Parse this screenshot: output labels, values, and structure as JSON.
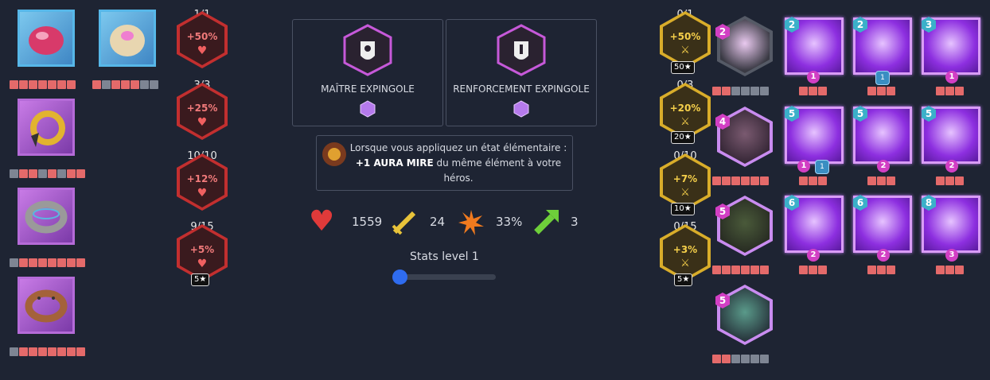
{
  "items_left": {
    "top_left_stars": 7,
    "top_left_filled": 7,
    "top_right_stars": 7,
    "top_right_filled": 4,
    "row2_stars": 6,
    "row2_filled": 3,
    "row3_stars": 6,
    "row3_filled": 6,
    "row4_stars": 6,
    "row4_filled": 6
  },
  "hp_bonuses": [
    {
      "count": "1/1",
      "label": "+50%"
    },
    {
      "count": "3/3",
      "label": "+25%"
    },
    {
      "count": "10/10",
      "label": "+12%"
    },
    {
      "count": "9/15",
      "label": "+5%",
      "tag": "5★"
    }
  ],
  "atk_bonuses": [
    {
      "count": "0/1",
      "label": "+50%",
      "tag": "50★"
    },
    {
      "count": "0/3",
      "label": "+20%",
      "tag": "20★"
    },
    {
      "count": "0/10",
      "label": "+7%",
      "tag": "10★"
    },
    {
      "count": "0/15",
      "label": "+3%",
      "tag": "5★"
    }
  ],
  "talents": [
    {
      "name": "MAÎTRE EXPINGOLE"
    },
    {
      "name": "RENFORCEMENT EXPINGOLE"
    }
  ],
  "description": {
    "part1": "Lorsque vous appliquez un état élémentaire : ",
    "bold": "+1 AURA MIRE",
    "part2": " du même élément à votre héros."
  },
  "stats": {
    "hp": "1559",
    "atk": "24",
    "crit": "33%",
    "speed": "3"
  },
  "stats_level_label": "Stats level 1",
  "stats_level_fraction": 0,
  "champions": [
    {
      "level": "2",
      "filled": 2,
      "total": 6
    },
    {
      "level": "4",
      "filled": 6,
      "total": 6
    },
    {
      "level": "5",
      "filled": 6,
      "total": 6
    },
    {
      "level": "5",
      "filled": 2,
      "total": 6
    }
  ],
  "skills": [
    {
      "level": "2",
      "pip": "1"
    },
    {
      "level": "2",
      "shield": "1"
    },
    {
      "level": "3",
      "pip": "1"
    },
    {
      "level": "5",
      "pip": "1",
      "shield": "1"
    },
    {
      "level": "5",
      "pip": "2"
    },
    {
      "level": "5",
      "pip": "2"
    },
    {
      "level": "6",
      "pip": "2"
    },
    {
      "level": "6",
      "pip": "2"
    },
    {
      "level": "8",
      "pip": "3"
    }
  ],
  "colors": {
    "background": "#1e2433",
    "hp_red": "#d43a3a",
    "atk_gold": "#e0b83a",
    "star_on": "#e46a6a",
    "skill_purple": "#8d2fe0"
  }
}
